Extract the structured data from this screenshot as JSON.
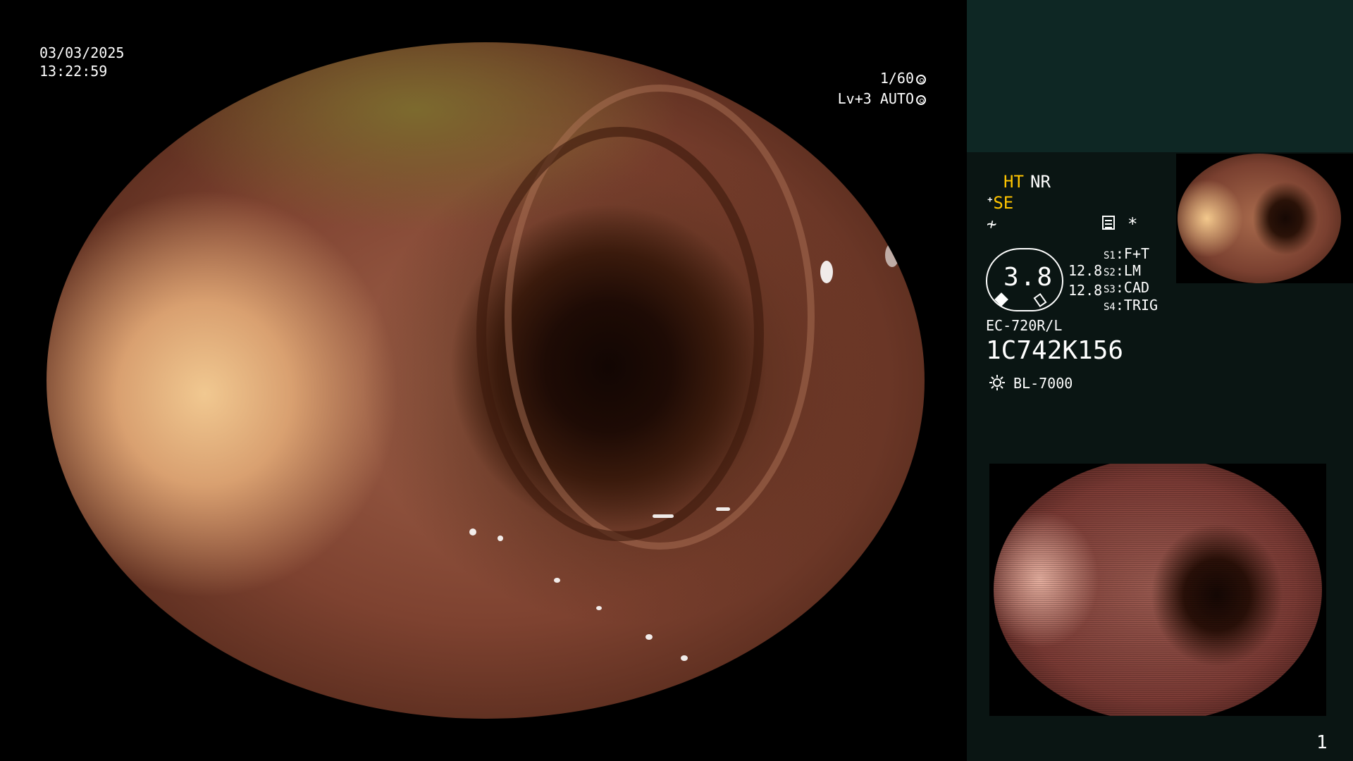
{
  "overlay": {
    "date": "03/03/2025",
    "time": "13:22:59",
    "shutter": "1/60",
    "iris": "Lv+3 AUTO"
  },
  "panel": {
    "ht": "HT",
    "nr": "NR",
    "se": "SE",
    "star": "*",
    "gauge_value": "3.8",
    "value_a": "12.8",
    "value_b": "12.8",
    "slots": [
      {
        "key": "S1",
        "value": "F+T"
      },
      {
        "key": "S2",
        "value": "LM"
      },
      {
        "key": "S3",
        "value": "CAD"
      },
      {
        "key": "S4",
        "value": "TRIG"
      }
    ],
    "scope_model": "EC-720R/L",
    "scope_serial": "1C742K156",
    "light_source": "BL-7000",
    "page_number": "1"
  },
  "colors": {
    "accent_yellow": "#ffc400",
    "panel_top": "#0e2724",
    "panel_info": "#0a1513"
  },
  "icons": [
    "shutter-icon",
    "iris-icon",
    "enhance-icon",
    "filter-icon",
    "list-icon",
    "light-icon"
  ]
}
